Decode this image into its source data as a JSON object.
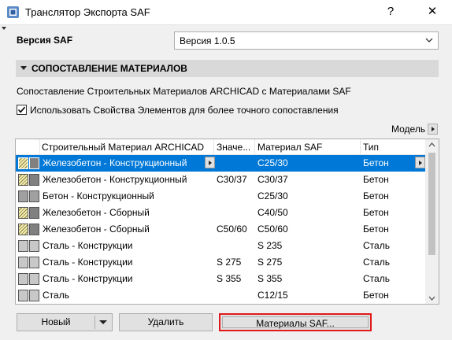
{
  "window": {
    "title": "Транслятор Экспорта SAF",
    "help_glyph": "?",
    "close_glyph": "✕"
  },
  "version": {
    "label": "Версия SAF",
    "selected": "Версия 1.0.5"
  },
  "section": {
    "title": "СОПОСТАВЛЕНИЕ МАТЕРИАЛОВ",
    "description": "Сопоставление Строительных Материалов ARCHICAD с Материалами SAF",
    "checkbox_label": "Использовать Свойства Элементов для более точного сопоставления",
    "checkbox_checked": true,
    "model_label": "Модель"
  },
  "table": {
    "headers": [
      "Строительный Материал ARCHICAD",
      "Значе...",
      "Материал SAF",
      "Тип"
    ],
    "rows": [
      {
        "material": "Железобетон - Конструкционный",
        "value": "",
        "saf": "C25/30",
        "type": "Бетон",
        "selected": true,
        "swatch": "hatch",
        "fill": "#808080"
      },
      {
        "material": "Железобетон - Конструкционный",
        "value": "C30/37",
        "saf": "C30/37",
        "type": "Бетон",
        "selected": false,
        "swatch": "hatch",
        "fill": "#808080"
      },
      {
        "material": "Бетон - Конструкционный",
        "value": "",
        "saf": "C25/30",
        "type": "Бетон",
        "selected": false,
        "swatch": "grey",
        "fill": "#a0a0a0"
      },
      {
        "material": "Железобетон - Сборный",
        "value": "",
        "saf": "C40/50",
        "type": "Бетон",
        "selected": false,
        "swatch": "hatch",
        "fill": "#808080"
      },
      {
        "material": "Железобетон - Сборный",
        "value": "C50/60",
        "saf": "C50/60",
        "type": "Бетон",
        "selected": false,
        "swatch": "hatch",
        "fill": "#808080"
      },
      {
        "material": "Сталь - Конструкции",
        "value": "",
        "saf": "S 235",
        "type": "Сталь",
        "selected": false,
        "swatch": "light",
        "fill": "#c8c8c8"
      },
      {
        "material": "Сталь - Конструкции",
        "value": "S 275",
        "saf": "S 275",
        "type": "Сталь",
        "selected": false,
        "swatch": "light",
        "fill": "#c8c8c8"
      },
      {
        "material": "Сталь - Конструкции",
        "value": "S 355",
        "saf": "S 355",
        "type": "Сталь",
        "selected": false,
        "swatch": "light",
        "fill": "#c8c8c8"
      },
      {
        "material": "Сталь",
        "value": "",
        "saf": "C12/15",
        "type": "Бетон",
        "selected": false,
        "swatch": "light",
        "fill": "#c8c8c8"
      }
    ]
  },
  "buttons": {
    "new": "Новый",
    "delete": "Удалить",
    "saf_materials": "Материалы SAF..."
  }
}
